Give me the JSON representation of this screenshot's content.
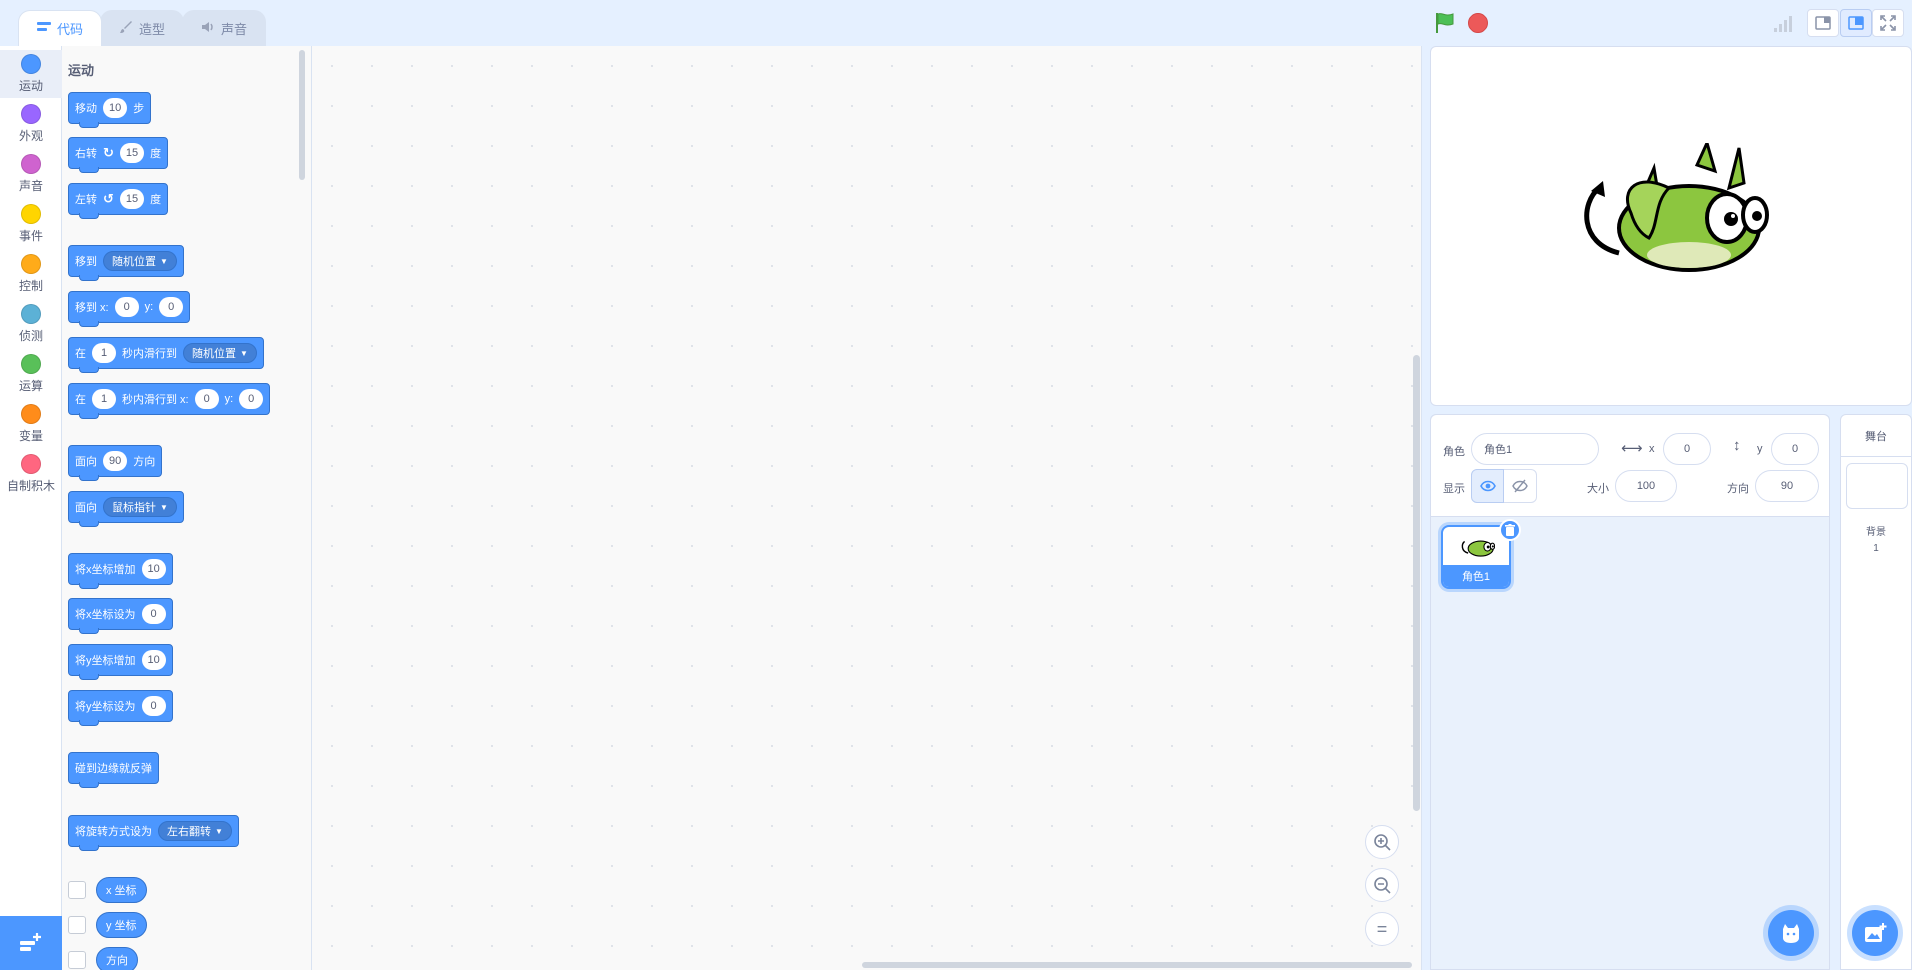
{
  "tabs": [
    {
      "label": "代码",
      "icon": "code-icon",
      "active": true
    },
    {
      "label": "造型",
      "icon": "brush-icon",
      "active": false
    },
    {
      "label": "声音",
      "icon": "speaker-icon",
      "active": false
    }
  ],
  "categories": [
    {
      "label": "运动",
      "color": "#4c97ff"
    },
    {
      "label": "外观",
      "color": "#9966ff"
    },
    {
      "label": "声音",
      "color": "#cf63cf"
    },
    {
      "label": "事件",
      "color": "#ffd500"
    },
    {
      "label": "控制",
      "color": "#ffab19"
    },
    {
      "label": "侦测",
      "color": "#5cb1d6"
    },
    {
      "label": "运算",
      "color": "#59c059"
    },
    {
      "label": "变量",
      "color": "#ff8c1a"
    },
    {
      "label": "自制积木",
      "color": "#ff6680"
    }
  ],
  "palette": {
    "section_title": "运动",
    "blocks": {
      "move": {
        "t1": "移动",
        "v1": "10",
        "t2": "步"
      },
      "turn_right": {
        "t1": "右转",
        "v1": "15",
        "t2": "度"
      },
      "turn_left": {
        "t1": "左转",
        "v1": "15",
        "t2": "度"
      },
      "goto": {
        "t1": "移到",
        "d1": "随机位置"
      },
      "goto_xy": {
        "t1": "移到 x:",
        "v1": "0",
        "t2": "y:",
        "v2": "0"
      },
      "glide": {
        "t1": "在",
        "v1": "1",
        "t2": "秒内滑行到",
        "d1": "随机位置"
      },
      "glide_xy": {
        "t1": "在",
        "v1": "1",
        "t2": "秒内滑行到 x:",
        "v2": "0",
        "t3": "y:",
        "v3": "0"
      },
      "point_dir": {
        "t1": "面向",
        "v1": "90",
        "t2": "方向"
      },
      "point_towards": {
        "t1": "面向",
        "d1": "鼠标指针"
      },
      "change_x": {
        "t1": "将x坐标增加",
        "v1": "10"
      },
      "set_x": {
        "t1": "将x坐标设为",
        "v1": "0"
      },
      "change_y": {
        "t1": "将y坐标增加",
        "v1": "10"
      },
      "set_y": {
        "t1": "将y坐标设为",
        "v1": "0"
      },
      "bounce": {
        "t1": "碰到边缘就反弹"
      },
      "rotation_style": {
        "t1": "将旋转方式设为",
        "d1": "左右翻转"
      }
    },
    "reporters": [
      "x 坐标",
      "y 坐标",
      "方向"
    ]
  },
  "zoom": {
    "zoom_in": "+",
    "zoom_out": "−",
    "reset": "="
  },
  "sprite_info": {
    "sprite_label": "角色",
    "sprite_name": "角色1",
    "x_label": "x",
    "x_value": "0",
    "y_label": "y",
    "y_value": "0",
    "show_label": "显示",
    "size_label": "大小",
    "size_value": "100",
    "direction_label": "方向",
    "direction_value": "90"
  },
  "sprites": [
    {
      "name": "角色1",
      "selected": true
    }
  ],
  "stage_pane": {
    "title": "舞台",
    "backdrop_label": "背景",
    "backdrop_count": "1"
  },
  "colors": {
    "accent": "#4c97ff",
    "stop": "#ec5959",
    "flag": "#4cbf56"
  }
}
